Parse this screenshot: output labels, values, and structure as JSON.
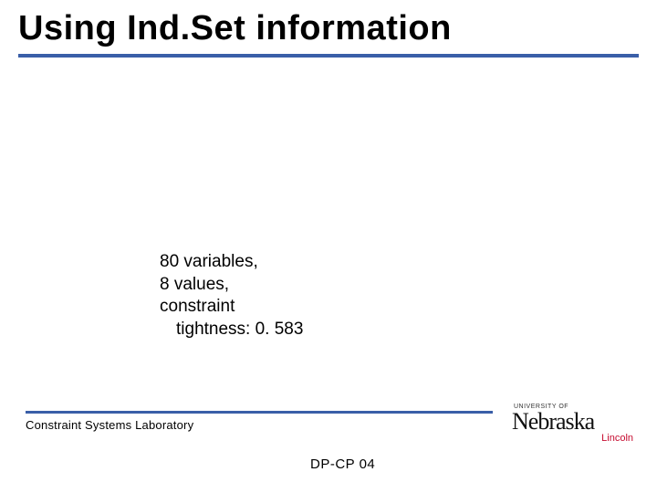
{
  "title": "Using Ind.Set information",
  "body": {
    "line1": "80 variables,",
    "line2": "8 values,",
    "line3": "constraint",
    "line4": "tightness: 0. 583"
  },
  "footer": {
    "lab": "Constraint Systems Laboratory",
    "code": "DP-CP 04"
  },
  "logo": {
    "univ": "UNIVERSITY OF",
    "name": "Nebraska",
    "city": "Lincoln"
  }
}
